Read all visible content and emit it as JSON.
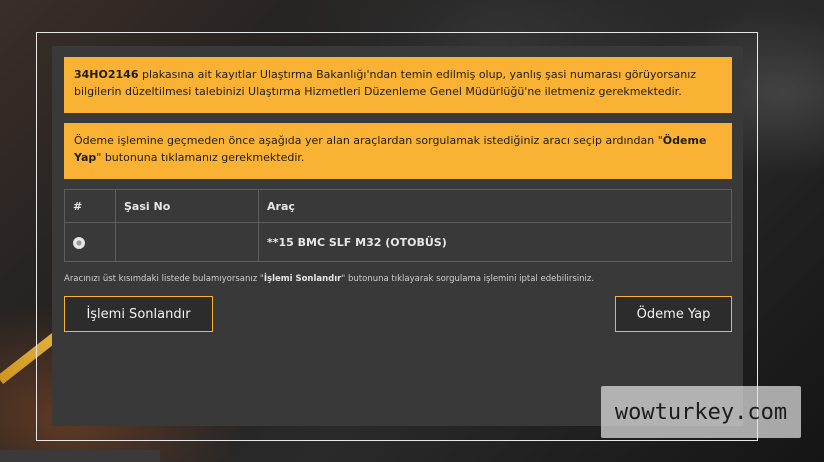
{
  "alerts": {
    "first": {
      "plate": "34HO2146",
      "text": " plakasına ait kayıtlar Ulaştırma Bakanlığı'ndan temin edilmiş olup, yanlış şasi numarası görüyorsanız bilgilerin düzeltilmesi talebinizi Ulaştırma Hizmetleri Düzenleme Genel Müdürlüğü'ne iletmeniz gerekmektedir."
    },
    "second": {
      "text_before": "Ödeme işlemine geçmeden önce aşağıda yer alan araçlardan sorgulamak istediğiniz aracı seçip ardından \"",
      "highlight": "Ödeme Yap",
      "text_after": "\" butonuna tıklamanız gerekmektedir."
    }
  },
  "table": {
    "headers": {
      "hash": "#",
      "sasi": "Şasi No",
      "arac": "Araç"
    },
    "rows": [
      {
        "sasi_no": "",
        "arac": "**15 BMC SLF M32 (OTOBÜS)"
      }
    ]
  },
  "note": {
    "before": "Aracınızı üst kısımdaki listede bulamıyorsanız \"",
    "highlight": "İşlemi Sonlandır",
    "after": "\" butonuna tıklayarak sorgulama işlemini iptal edebilirsiniz."
  },
  "buttons": {
    "cancel": "İşlemi Sonlandır",
    "pay": "Ödeme Yap"
  },
  "watermark": "wowturkey.com",
  "colors": {
    "accent": "#f9b233",
    "panel": "#393939"
  }
}
